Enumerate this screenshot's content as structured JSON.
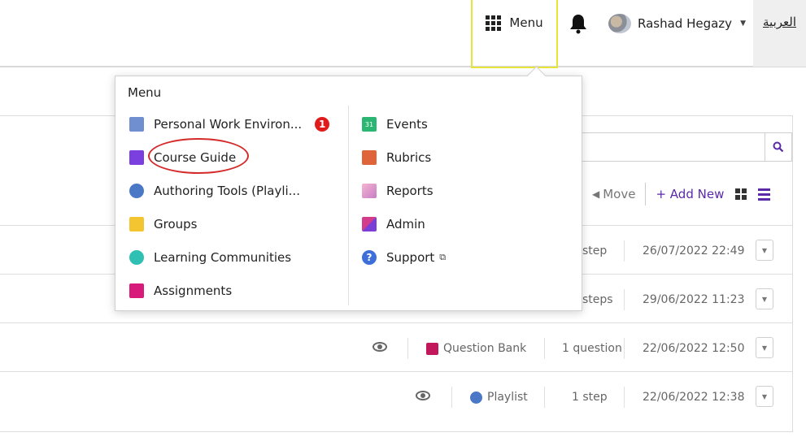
{
  "topbar": {
    "menu_label": "Menu",
    "user_name": "Rashad Hegazy",
    "language_link": "العربية"
  },
  "toolbar": {
    "move_label": "Move",
    "add_new_label": "+ Add New"
  },
  "menu": {
    "title": "Menu",
    "left_items": [
      {
        "label": "Personal Work Environ...",
        "icon": "personal-environment-icon",
        "badge": "1"
      },
      {
        "label": "Course Guide",
        "icon": "course-guide-icon"
      },
      {
        "label": "Authoring Tools (Playli...",
        "icon": "authoring-tools-icon"
      },
      {
        "label": "Groups",
        "icon": "groups-icon"
      },
      {
        "label": "Learning Communities",
        "icon": "learning-communities-icon"
      },
      {
        "label": "Assignments",
        "icon": "assignments-icon"
      }
    ],
    "right_items": [
      {
        "label": "Events",
        "icon": "calendar-icon",
        "icon_text": "31"
      },
      {
        "label": "Rubrics",
        "icon": "rubrics-icon"
      },
      {
        "label": "Reports",
        "icon": "reports-icon"
      },
      {
        "label": "Admin",
        "icon": "admin-icon"
      },
      {
        "label": "Support",
        "icon": "help-icon",
        "external": "⧉"
      }
    ]
  },
  "rows": [
    {
      "type": "",
      "count": "step",
      "date": "26/07/2022 22:49"
    },
    {
      "type": "",
      "count": "steps",
      "date": "29/06/2022 11:23"
    },
    {
      "type": "Question Bank",
      "count": "1 question",
      "date": "22/06/2022 12:50"
    },
    {
      "type": "Playlist",
      "count": "1 step",
      "date": "22/06/2022 12:38"
    }
  ],
  "colors": {
    "accent": "#5a2aa8",
    "menu_highlight": "#e8e53a",
    "badge": "#e01b1b",
    "annotation_circle": "#d42a2a"
  }
}
